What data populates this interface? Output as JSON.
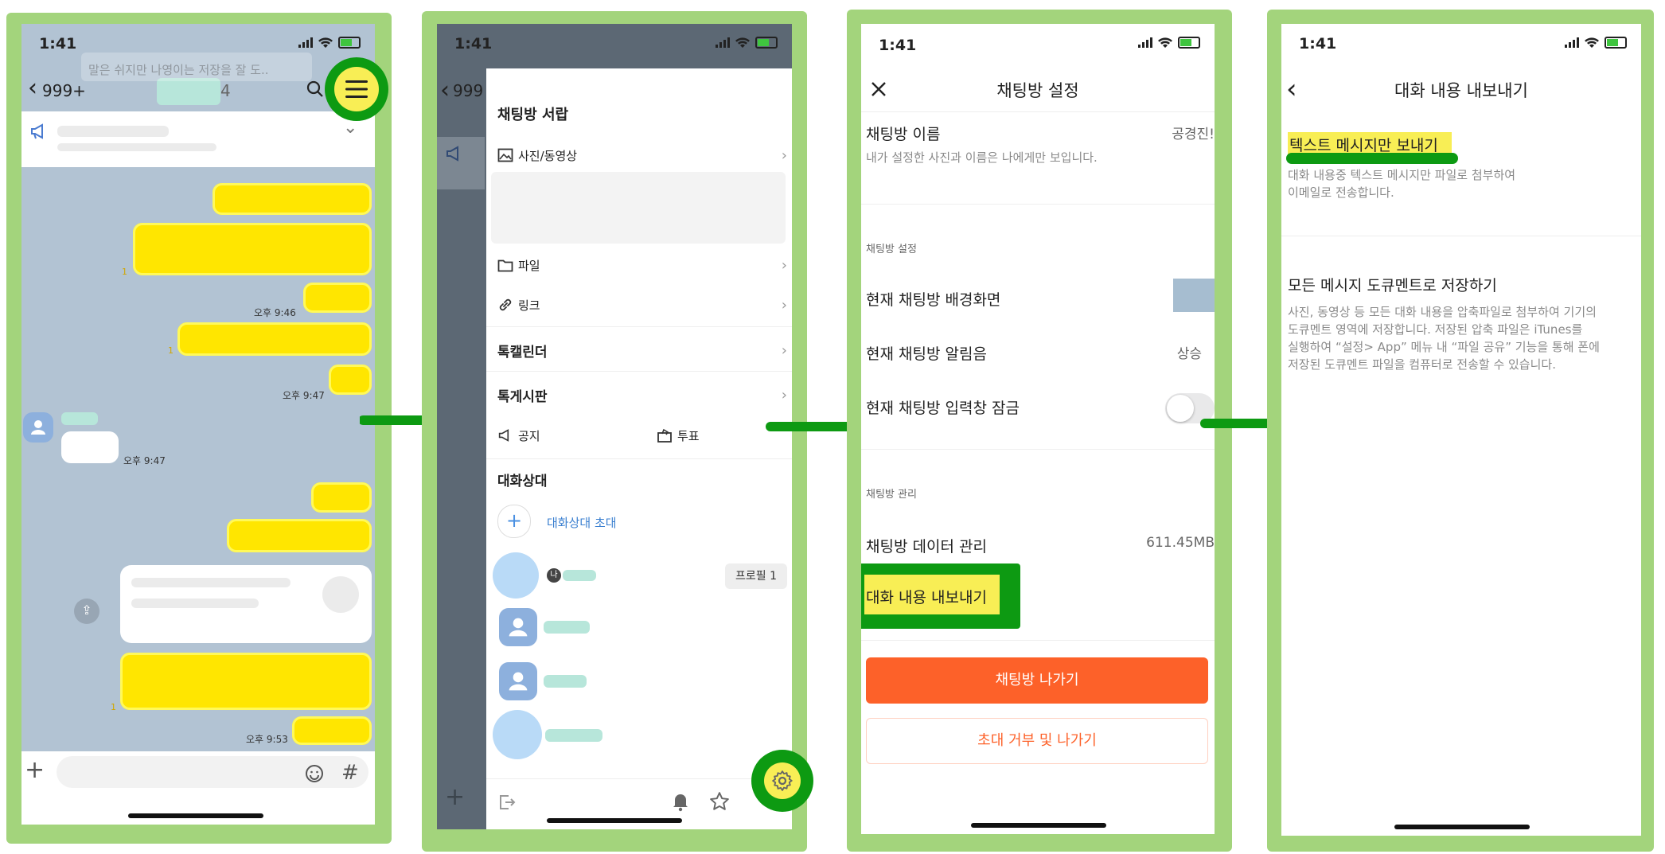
{
  "status": {
    "time": "1:41"
  },
  "chat": {
    "back_label": "999+",
    "member_count": "4",
    "notice_bar": "",
    "notice_text": "말은 쉬지만 나영이는 저장을 잘 도..",
    "timestamps": [
      "오후 9:46",
      "오후 9:47",
      "오후 9:47",
      "오후 9:53"
    ],
    "read_count": "1"
  },
  "drawer": {
    "title": "채팅방 서랍",
    "media": "사진/동영상",
    "file": "파일",
    "link": "링크",
    "calendar": "톡캘린더",
    "board": "톡게시판",
    "notice": "공지",
    "vote": "투표",
    "members_title": "대화상대",
    "invite": "대화상대 초대",
    "profile_btn": "프로필 1",
    "me_badge": "나",
    "back_label": "999"
  },
  "settings": {
    "title": "채팅방 설정",
    "name_label": "채팅방 이름",
    "name_value": "공경진!",
    "name_desc": "내가 설정한 사진과 이름은 나에게만 보입니다.",
    "section1": "채팅방 설정",
    "bg_label": "현재 채팅방 배경화면",
    "sound_label": "현재 채팅방 알림음",
    "sound_value": "상승",
    "lock_label": "현재 채팅방 입력창 잠금",
    "section2": "채팅방 관리",
    "data_label": "채팅방 데이터 관리",
    "data_value": "611.45MB",
    "export_label": "대화 내용 내보내기",
    "leave_btn": "채팅방 나가기",
    "block_leave_btn": "초대 거부 및 나가기"
  },
  "export": {
    "title": "대화 내용 내보내기",
    "opt1_title": "텍스트 메시지만 보내기",
    "opt1_desc1": "대화 내용중 텍스트 메시지만 파일로 첨부하여",
    "opt1_desc2": "이메일로 전송합니다.",
    "opt2_title": "모든 메시지 도큐멘트로 저장하기",
    "opt2_desc1": "사진, 동영상 등 모든 대화 내용을 압축파일로 첨부하여 기기의",
    "opt2_desc2": "도큐멘트 영역에 저장합니다. 저장된 압축 파일은 iTunes를",
    "opt2_desc3": "실행하여 “설정> App” 메뉴 내 “파일 공유” 기능을 통해 폰에",
    "opt2_desc4": "저장된 도큐멘트 파일을 컴퓨터로 전송할 수 있습니다."
  },
  "colors": {
    "frame": "#a3d47c",
    "highlight_green": "#0d9a12",
    "kakao_yellow": "#ffe600",
    "chat_bg": "#b2c3d3",
    "leave_orange": "#fd6129"
  }
}
